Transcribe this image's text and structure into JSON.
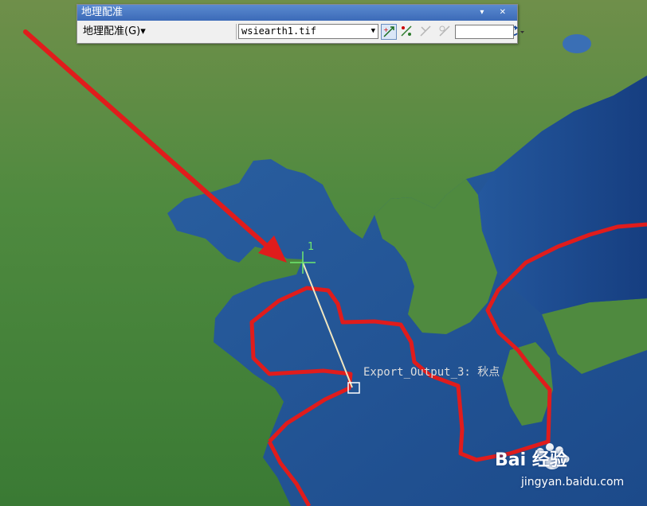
{
  "toolbar": {
    "title": "地理配准",
    "title_controls": "▾ ✕",
    "menu_label": "地理配准(G)",
    "menu_arrow": "▾",
    "layer_combo_value": "wsiearth1.tif",
    "combo_arrow": "▼",
    "tools": [
      {
        "icon": "add-control-points-icon",
        "state": "active"
      },
      {
        "icon": "auto-registration-icon",
        "state": "enabled"
      },
      {
        "icon": "select-link-icon",
        "state": "disabled"
      },
      {
        "icon": "zoom-to-selected-link-icon",
        "state": "disabled"
      },
      {
        "icon": "delete-link-icon",
        "state": "disabled"
      },
      {
        "icon": "viewer-icon",
        "state": "enabled"
      },
      {
        "icon": "link-table-icon",
        "state": "enabled"
      },
      {
        "icon": "rotate-icon",
        "state": "enabled"
      }
    ],
    "rotation_value": ""
  },
  "map": {
    "control_point_label": "1",
    "feature_label": "Export_Output_3: 秋点"
  },
  "watermark": {
    "main": "Bai 经验",
    "sub": "jingyan.baidu.com"
  },
  "colors": {
    "boundary": "#e01c1c",
    "annotation_arrow": "#e01c1c",
    "link_line": "#f0e6c0",
    "cross_marker": "#6fe86f",
    "sea": "#2a5a9a",
    "land": "#4f8a3f",
    "title_bar": "#4a7ac8"
  }
}
